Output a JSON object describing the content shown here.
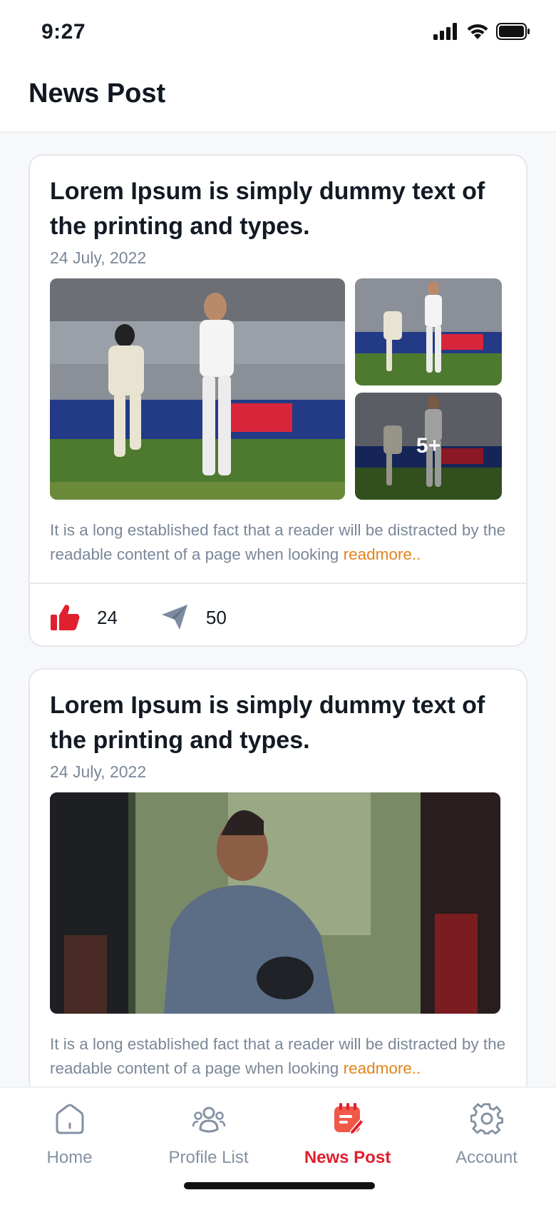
{
  "status_bar": {
    "time": "9:27"
  },
  "header": {
    "title": "News Post"
  },
  "posts": [
    {
      "title": "Lorem Ipsum is simply dummy text of the printing and types.",
      "date": "24 July, 2022",
      "description": "It is a long established fact that a reader will be distracted by the readable content of a page when looking",
      "readmore": "readmore..",
      "more_images": "5+",
      "likes": "24",
      "shares": "50"
    },
    {
      "title": "Lorem Ipsum is simply dummy text of the printing and types.",
      "date": "24 July, 2022",
      "description": "It is a long established fact that a reader will be distracted by the readable content of a page when looking",
      "readmore": "readmore.."
    }
  ],
  "nav": {
    "items": [
      {
        "label": "Home",
        "icon": "home-icon"
      },
      {
        "label": "Profile List",
        "icon": "users-icon"
      },
      {
        "label": "News Post",
        "icon": "news-icon",
        "active": true
      },
      {
        "label": "Account",
        "icon": "gear-icon"
      }
    ]
  },
  "colors": {
    "accent": "#e0202e",
    "readmore": "#e0841f",
    "muted": "#7b8798"
  }
}
